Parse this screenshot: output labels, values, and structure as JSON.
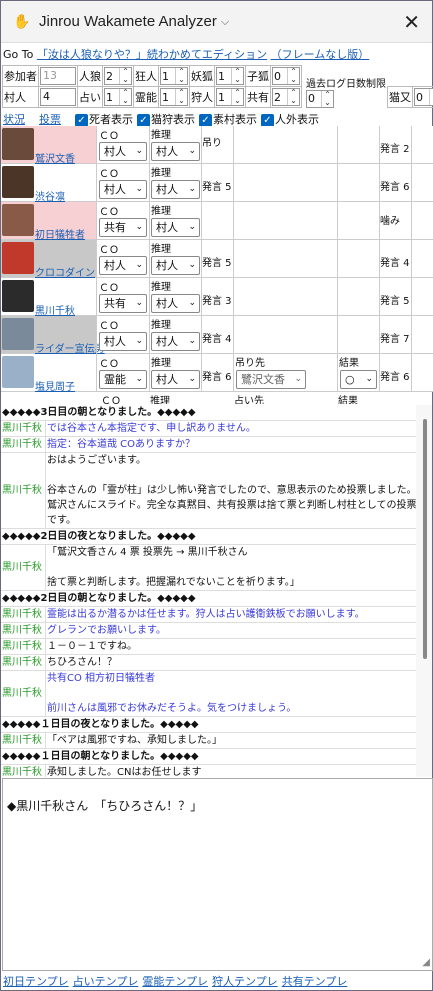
{
  "window": {
    "title": "Jinrou Wakamete Analyzer",
    "close": "✕"
  },
  "goto": {
    "prefix": "Go To",
    "link1": "「汝は人狼なりや？」続わかめてエディション",
    "link2": "（フレームなし版）"
  },
  "settings": {
    "participants_label": "参加者",
    "participants_value": "13",
    "villagers_label": "村人",
    "villagers_value": "4",
    "wolf_label": "人狼",
    "wolf_value": "2",
    "seer_label": "占い",
    "seer_value": "1",
    "madman_label": "狂人",
    "madman_value": "1",
    "medium_label": "霊能",
    "medium_value": "1",
    "fox_label": "妖狐",
    "fox_value": "1",
    "hunter_label": "狩人",
    "hunter_value": "1",
    "child_fox_label": "子狐",
    "child_fox_value": "0",
    "mason_label": "共有",
    "mason_value": "2",
    "cat_label": "猫又",
    "cat_value": "0",
    "past_log_label": "過去ログ日数制限",
    "past_log_value": "0"
  },
  "tabs": {
    "status": "状況",
    "vote": "投票",
    "cb_dead": "死者表示",
    "cb_hunt": "猫狩表示",
    "cb_raw": "素村表示",
    "cb_outside": "人外表示"
  },
  "player_headers": {
    "co": "ＣＯ",
    "guess": "推理",
    "hang_target": "吊り先",
    "result": "結果",
    "divine_target": "占い先"
  },
  "players": [
    {
      "name": "鷲沢文香",
      "co": "村人",
      "guess": "村人",
      "c1": "吊り",
      "c2": "",
      "c3": "",
      "c4": "発言 2",
      "bg": "#f7d0d4",
      "av": "#6a4a3a"
    },
    {
      "name": "渋谷凛",
      "co": "村人",
      "guess": "村人",
      "c1": "発言 5",
      "c2": "",
      "c3": "",
      "c4": "発言 6",
      "bg": "#ffffff",
      "av": "#4a3526"
    },
    {
      "name": "初日犠牲者",
      "co": "共有",
      "guess": "村人",
      "c1": "",
      "c2": "",
      "c3": "",
      "c4": "噛み",
      "bg": "#f7d0d4",
      "av": "#8a5a48"
    },
    {
      "name": "クロコダイン",
      "co": "村人",
      "guess": "村人",
      "c1": "発言 5",
      "c2": "",
      "c3": "",
      "c4": "発言 4",
      "bg": "#c8c8c8",
      "av": "#c0392b"
    },
    {
      "name": "黒川千秋",
      "co": "共有",
      "guess": "村人",
      "c1": "発言 3",
      "c2": "",
      "c3": "",
      "c4": "発言 5",
      "bg": "#ffffff",
      "av": "#2b2b2b"
    },
    {
      "name": "ライダー宣伝男",
      "co": "村人",
      "guess": "村人",
      "c1": "発言 4",
      "c2": "",
      "c3": "",
      "c4": "発言 7",
      "bg": "#c8c8c8",
      "av": "#7a8a9a"
    },
    {
      "name": "塩見周子",
      "co": "霊能",
      "guess": "村人",
      "c1": "発言 6",
      "c2": "鷺沢文香",
      "c3": "○",
      "c4": "発言 6",
      "bg": "#ffffff",
      "av": "#9ab0c8"
    }
  ],
  "log": [
    {
      "type": "sys",
      "text": "◆◆◆◆◆3日目の朝となりました。◆◆◆◆◆"
    },
    {
      "speaker": "黒川千秋",
      "text": "では谷本さん本指定です、申し訳ありません。",
      "blue": true
    },
    {
      "speaker": "黒川千秋",
      "text": "指定：谷本道哉 COありますか？",
      "blue": true
    },
    {
      "speaker": "黒川千秋",
      "text": "おはようございます。\n\n谷本さんの「霊が柱」は少し怖い発言でしたので、意思表示のため投票しました。\n鷲沢さんにスライド。完全な真黙目、共有投票は捨て票と判断し村柱としての投票です。",
      "blue": false
    },
    {
      "type": "sys",
      "text": "◆◆◆◆◆2日目の夜となりました。◆◆◆◆◆"
    },
    {
      "speaker": "黒川千秋",
      "text": "「鷲沢文香さん 4 票 投票先 → 黒川千秋さん\n\n捨て票と判断します。把握漏れでないことを祈ります。」",
      "blue": false
    },
    {
      "type": "sys",
      "text": "◆◆◆◆◆2日目の朝となりました。◆◆◆◆◆"
    },
    {
      "speaker": "黒川千秋",
      "text": "霊能は出るか潜るかは任せます。狩人は占い護衛鉄板でお願いします。",
      "blue": true
    },
    {
      "speaker": "黒川千秋",
      "text": "グレランでお願いします。",
      "blue": true
    },
    {
      "speaker": "黒川千秋",
      "text": "１－０－１ですね。",
      "blue": false
    },
    {
      "speaker": "黒川千秋",
      "text": "ちひろさん！？",
      "blue": false
    },
    {
      "speaker": "黒川千秋",
      "text": "共有CO 相方初日犠牲者\n\n前川さんは風邪でお休みだそうよ。気をつけましょう。",
      "blue": true
    },
    {
      "type": "sys",
      "text": "◆◆◆◆◆１日目の夜となりました。◆◆◆◆◆"
    },
    {
      "speaker": "黒川千秋",
      "text": "「ペアは風邪ですね、承知しました。」",
      "blue": false
    },
    {
      "type": "sys",
      "text": "◆◆◆◆◆１日目の朝となりました。◆◆◆◆◆"
    },
    {
      "speaker": "黒川千秋",
      "text": "承知しました。CNはお任せします",
      "blue": false
    }
  ],
  "editor": {
    "text": "◆黒川千秋さん　「ちひろさん！？」"
  },
  "templates": [
    "初日テンプレ",
    "占いテンプレ",
    "霊能テンプレ",
    "狩人テンプレ",
    "共有テンプレ"
  ]
}
